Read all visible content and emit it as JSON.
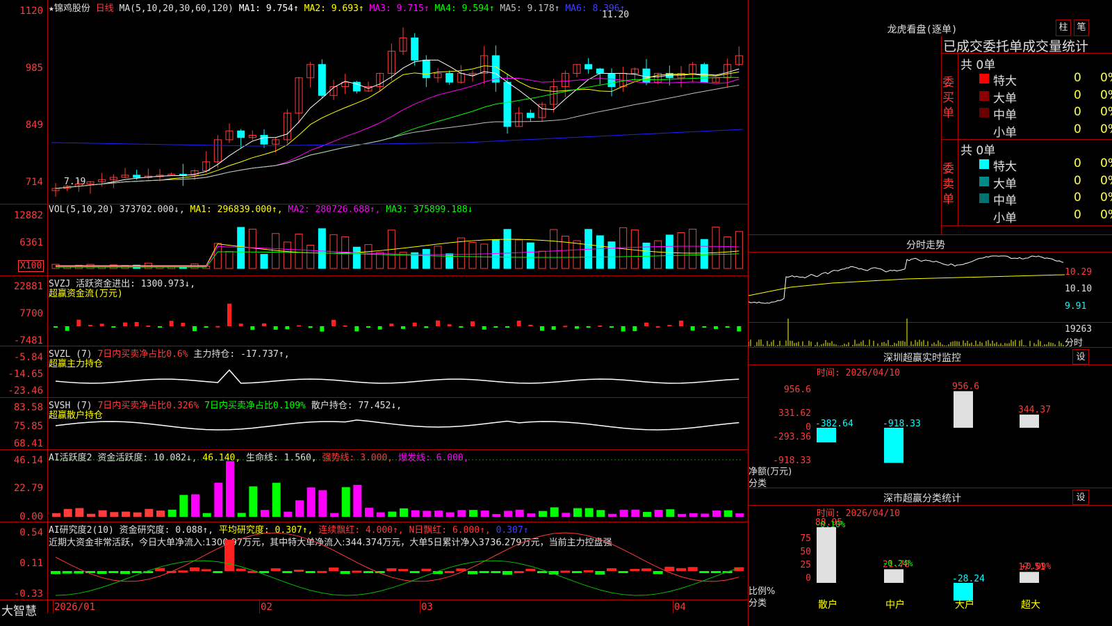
{
  "stock": {
    "name": "★锦鸡股份",
    "period": "日线",
    "ma_def": "MA(5,10,20,30,60,120)"
  },
  "price_panel": {
    "ma_readouts": [
      {
        "label": "MA1: 9.754↑",
        "color": "#ffffff"
      },
      {
        "label": "MA2: 9.693↑",
        "color": "#ffff00"
      },
      {
        "label": "MA3: 9.715↑",
        "color": "#ff00ff"
      },
      {
        "label": "MA4: 9.594↑",
        "color": "#00ff00"
      },
      {
        "label": "MA5: 9.178↑",
        "color": "#c0c0c0"
      },
      {
        "label": "MA6: 8.396↑",
        "color": "#4040ff"
      }
    ],
    "y_ticks": [
      "1120",
      "985",
      "849",
      "714"
    ],
    "high_mark": "11.20",
    "low_mark": "7.19"
  },
  "vol_panel": {
    "title": "VOL(5,10,20)",
    "value": "373702.000↓,",
    "ma1": "MA1: 296839.000↑,",
    "ma2": "MA2: 280726.688↑,",
    "ma3": "MA3: 375899.188↓",
    "y_ticks": [
      "12882",
      "6361",
      "X100"
    ]
  },
  "svzj_panel": {
    "title": "SVZJ",
    "sub": "活跃资金进出: 1300.973↓,",
    "name": "超赢资金流(万元)",
    "y_ticks": [
      "22881",
      "7700",
      "-7481"
    ]
  },
  "svzl_panel": {
    "title": "SVZL (7)",
    "t1": "7日内买卖净占比0.6%",
    "t2": "主力持仓: -17.737↑,",
    "name": "超赢主力持仓",
    "y_ticks": [
      "-5.84",
      "-14.65",
      "-23.46"
    ]
  },
  "svsh_panel": {
    "title": "SVSH (7)",
    "t1": "7日内买卖净占比0.326%",
    "t2": "7日内买卖净占比0.109%",
    "t3": "散户持仓: 77.452↓,",
    "name": "超赢散户持仓",
    "y_ticks": [
      "83.58",
      "75.85",
      "68.41"
    ]
  },
  "ai_active_panel": {
    "title": "AI活跃度2",
    "t1": "资金活跃度: 10.082↓,",
    "t2": "46.140,",
    "t3": "生命线: 1.560,",
    "t4": "强势线: 3.000,",
    "t5": "爆发线: 6.000,",
    "y_ticks": [
      "46.14",
      "22.79",
      "0.00"
    ]
  },
  "ai_research_panel": {
    "title": "AI研究度2(10)",
    "t1": "资金研究度: 0.088↑,",
    "t2": "平均研究度: 0.307↑,",
    "t3": "连续飘红: 4.000↑,",
    "t4": "N日飘红: 6.000↑,",
    "t5": "0.307↑",
    "comment": "近期大资金非常活跃，今日大单净流入:1300.97万元，其中特大单净流入:344.374万元，大单5日累计净入3736.279万元，当前主力控盘强",
    "y_ticks": [
      "0.54",
      "0.11",
      "-0.33"
    ]
  },
  "x_axis": {
    "labels": [
      "2026/01",
      "02",
      "03",
      "04"
    ],
    "brand": "大智慧"
  },
  "dragon_tiger": {
    "title": "龙虎看盘(逐单)",
    "btn1": "柱",
    "btn2": "笔",
    "header": "已成交委托单成交量统计",
    "buy_label": "委买单",
    "sell_label": "委卖单",
    "buy_total": "共 0单",
    "sell_total": "共 0单",
    "buy_rows": [
      {
        "name": "特大",
        "count": "0",
        "pct": "0%",
        "color": "#ff0000"
      },
      {
        "name": "大单",
        "count": "0",
        "pct": "0%",
        "color": "#8b0000"
      },
      {
        "name": "中单",
        "count": "0",
        "pct": "0%",
        "color": "#6b0000"
      },
      {
        "name": "小单",
        "count": "0",
        "pct": "0%",
        "color": "#000000"
      }
    ],
    "sell_rows": [
      {
        "name": "特大",
        "count": "0",
        "pct": "0%",
        "color": "#00ffff"
      },
      {
        "name": "大单",
        "count": "0",
        "pct": "0%",
        "color": "#008b8b"
      },
      {
        "name": "中单",
        "count": "0",
        "pct": "0%",
        "color": "#007070"
      },
      {
        "name": "小单",
        "count": "0",
        "pct": "0%",
        "color": "#000000"
      }
    ]
  },
  "intraday": {
    "title": "分时走势",
    "y_ticks": [
      "10.29",
      "10.10",
      "9.91"
    ],
    "vol_tick": "19263",
    "vol_unit": "分时"
  },
  "sz_monitor": {
    "title": "深圳超赢实时监控",
    "btn": "设",
    "time": "时间: 2026/04/10",
    "y_ticks": [
      "956.6",
      "331.62",
      "0",
      "-293.36",
      "-918.33"
    ],
    "unit": "净额(万元)",
    "cat_label": "分类",
    "categories": [
      "散户",
      "中户",
      "大户",
      "超大"
    ],
    "values": [
      -382.64,
      -918.33,
      956.6,
      344.37
    ],
    "value_labels": [
      "-382.64",
      "-918.33",
      "956.6",
      "344.37"
    ]
  },
  "sz_class": {
    "title": "深市超赢分类统计",
    "btn": "设",
    "time": "时间: 2026/04/10",
    "y_ticks": [
      "75",
      "50",
      "25",
      "0"
    ],
    "unit": "比例%",
    "cat_label": "分类",
    "categories": [
      "散户",
      "中户",
      "大户",
      "超大"
    ],
    "pct_labels": [
      "-0.10%",
      "-0.24%",
      "",
      "+0.09%"
    ],
    "values": [
      88.95,
      21.78,
      -28.24,
      17.51
    ],
    "value_labels": [
      "88.95",
      "21.78",
      "-28.24",
      "17.51"
    ]
  }
}
